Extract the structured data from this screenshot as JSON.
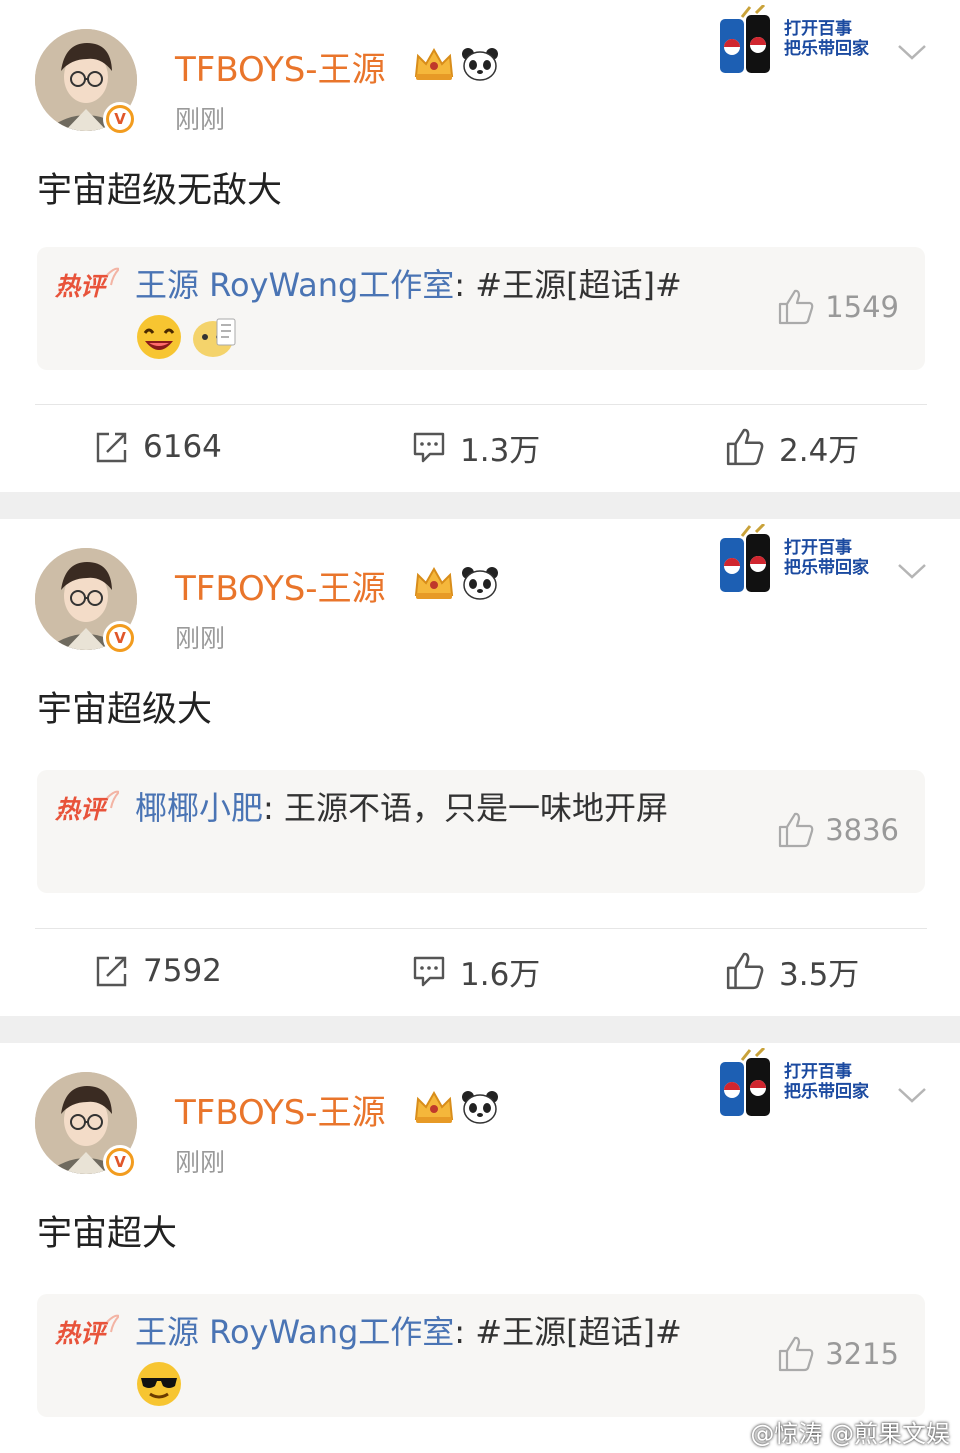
{
  "posts": [
    {
      "username": "TFBOYS-王源",
      "timestamp": "刚刚",
      "content": "宇宙超级无敌大",
      "ad": {
        "line1": "打开百事",
        "line2": "把乐带回家"
      },
      "hot_comment": {
        "label": "热评",
        "user": "王源 RoyWang工作室",
        "text": ": #王源[超话]#",
        "emojis": [
          "laughing-emoji-icon",
          "doge-emoji-icon"
        ],
        "likes": "1549"
      },
      "actions": {
        "shares": "6164",
        "comments": "1.3万",
        "likes": "2.4万"
      }
    },
    {
      "username": "TFBOYS-王源",
      "timestamp": "刚刚",
      "content": "宇宙超级大",
      "ad": {
        "line1": "打开百事",
        "line2": "把乐带回家"
      },
      "hot_comment": {
        "label": "热评",
        "user": "椰椰小肥",
        "text": ": 王源不语，只是一味地开屏",
        "emojis": [],
        "likes": "3836"
      },
      "actions": {
        "shares": "7592",
        "comments": "1.6万",
        "likes": "3.5万"
      }
    },
    {
      "username": "TFBOYS-王源",
      "timestamp": "刚刚",
      "content": "宇宙超大",
      "ad": {
        "line1": "打开百事",
        "line2": "把乐带回家"
      },
      "hot_comment": {
        "label": "热评",
        "user": "王源 RoyWang工作室",
        "text": ": #王源[超话]#",
        "emojis": [
          "sunglasses-emoji-icon"
        ],
        "likes": "3215"
      }
    }
  ],
  "watermark": "@惊涛 @煎果文娱",
  "colors": {
    "username": "#e9752b",
    "link": "#4a74b4",
    "hot_label": "#e8533a",
    "verified": "#f29c1f"
  }
}
